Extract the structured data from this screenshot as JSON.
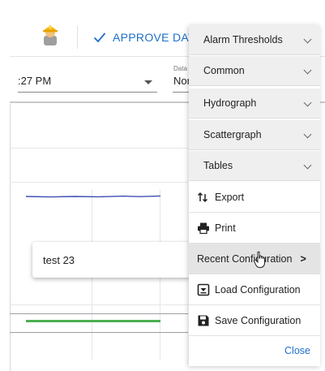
{
  "toolbar": {
    "approve_label": "APPROVE DATA",
    "worker_icon": "worker-helmet-icon",
    "approve_icon": "checkmark-icon"
  },
  "filters": {
    "date_value": ":27 PM",
    "data_label": "Data",
    "data_value": "Nor"
  },
  "chart": {
    "series_colors": [
      "#3f4fb5",
      "#4caf50"
    ]
  },
  "submenu": {
    "items": [
      {
        "label": "test 23"
      }
    ]
  },
  "menu": {
    "groups": [
      {
        "label": "Alarm Thresholds"
      },
      {
        "label": "Common"
      },
      {
        "label": "Hydrograph"
      },
      {
        "label": "Scattergraph"
      },
      {
        "label": "Tables"
      }
    ],
    "actions": [
      {
        "label": "Export",
        "icon": "export-arrows-icon"
      },
      {
        "label": "Print",
        "icon": "printer-icon"
      },
      {
        "label": "Recent Configuration",
        "arrow": ">",
        "icon": "chevron-right-icon"
      },
      {
        "label": "Load Configuration",
        "icon": "load-box-icon"
      },
      {
        "label": "Save Configuration",
        "icon": "save-disk-icon"
      }
    ],
    "close_label": "Close"
  },
  "colors": {
    "accent": "#1e6fc9",
    "menu_group_bg": "#efefef",
    "active_item_bg": "#e4e4e4"
  }
}
